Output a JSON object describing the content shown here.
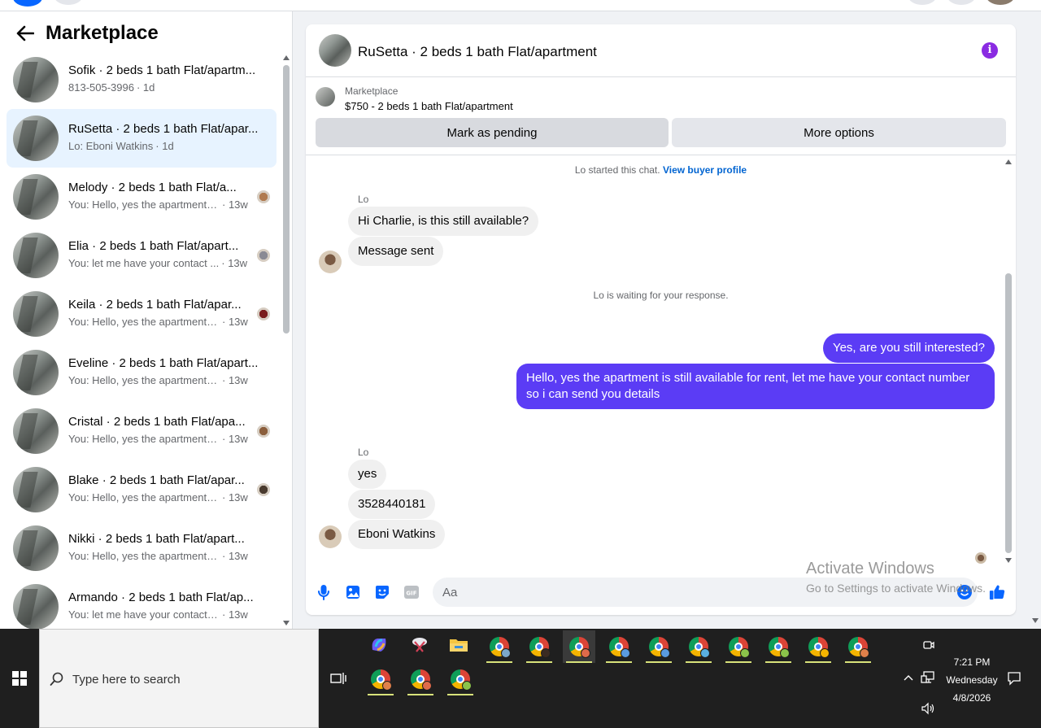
{
  "sidebar": {
    "title": "Marketplace",
    "conversations": [
      {
        "name": "Sofik · 2 beds 1 bath Flat/apartm...",
        "snippet": "813-505-3996",
        "time": "· 1d",
        "active": false,
        "mini_color": ""
      },
      {
        "name": "RuSetta · 2 beds 1 bath Flat/apar...",
        "snippet": "Lo: Eboni Watkins",
        "time": "· 1d",
        "active": true,
        "mini_color": ""
      },
      {
        "name": "Melody · 2 beds 1 bath Flat/a...",
        "snippet": "You: Hello, yes the apartment i...",
        "time": "· 13w",
        "active": false,
        "mini_color": "#b07a4f"
      },
      {
        "name": "Elia · 2 beds 1 bath Flat/apart...",
        "snippet": "You: let me have your contact ...",
        "time": "· 13w",
        "active": false,
        "mini_color": "#8a8a94"
      },
      {
        "name": "Keila · 2 beds 1 bath Flat/apar...",
        "snippet": "You: Hello, yes the apartment i...",
        "time": "· 13w",
        "active": false,
        "mini_color": "#7a1d1d"
      },
      {
        "name": "Eveline · 2 beds 1 bath Flat/apart...",
        "snippet": "You: Hello, yes the apartment is st...",
        "time": "· 13w",
        "active": false,
        "mini_color": ""
      },
      {
        "name": "Cristal · 2 beds 1 bath Flat/apa...",
        "snippet": "You: Hello, yes the apartment i...",
        "time": "· 13w",
        "active": false,
        "mini_color": "#8b5e3c"
      },
      {
        "name": "Blake · 2 beds 1 bath Flat/apar...",
        "snippet": "You: Hello, yes the apartment i...",
        "time": "· 13w",
        "active": false,
        "mini_color": "#4a3b2f"
      },
      {
        "name": "Nikki · 2 beds 1 bath Flat/apart...",
        "snippet": "You: Hello, yes the apartment is st...",
        "time": "· 13w",
        "active": false,
        "mini_color": ""
      },
      {
        "name": "Armando · 2 beds 1 bath Flat/ap...",
        "snippet": "You: let me have your contact nu...",
        "time": "· 13w",
        "active": false,
        "mini_color": ""
      }
    ]
  },
  "chat": {
    "title": "RuSetta · 2 beds 1 bath Flat/apartment",
    "listing": {
      "source": "Marketplace",
      "price_line": "$750 - 2 beds 1 bath Flat/apartment"
    },
    "buttons": {
      "pending": "Mark as pending",
      "more": "More options"
    },
    "started_text": "Lo started this chat.",
    "view_profile": "View buyer profile",
    "waiting_text": "Lo is waiting for your response.",
    "sender_name": "Lo",
    "messages": {
      "in1": "Hi Charlie, is this still available?",
      "in2": "Message sent",
      "out1": "Yes, are you still interested?",
      "out2": "Hello, yes the apartment is still available for rent, let me have your contact number so i can send you details",
      "in3": "yes",
      "in4": "3528440181",
      "in5": "Eboni Watkins"
    },
    "composer_placeholder": "Aa"
  },
  "watermark": {
    "line1": "Activate Windows",
    "line2": "Go to Settings to activate Windows."
  },
  "taskbar": {
    "search_placeholder": "Type here to search",
    "time": "7:21 PM",
    "day": "Wednesday",
    "date": "4/8/2026"
  },
  "colors": {
    "accent_blue": "#0866ff",
    "outgoing_bubble": "#5b3cf5",
    "info_icon": "#8a2be2",
    "link": "#0064d1"
  }
}
